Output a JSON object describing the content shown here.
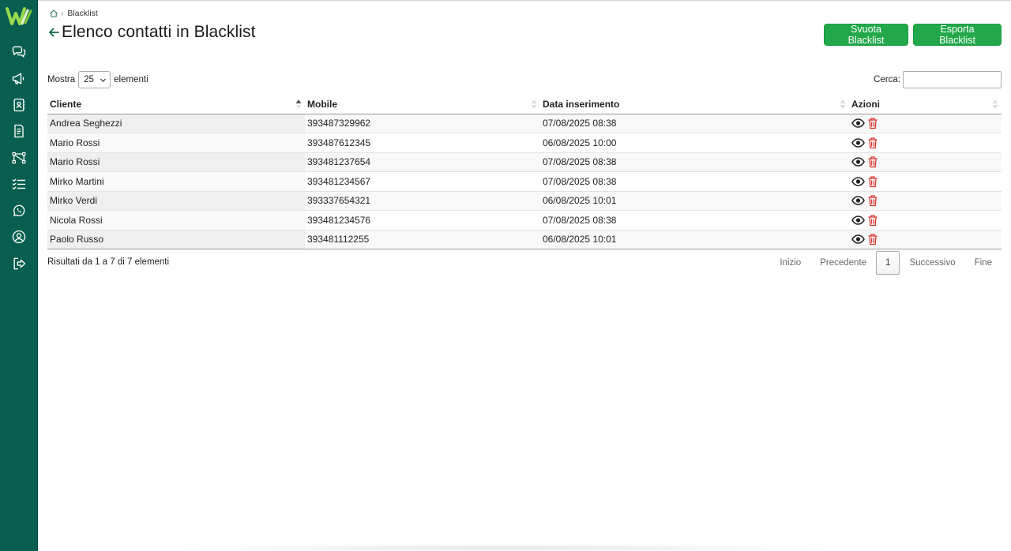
{
  "breadcrumb": {
    "current": "Blacklist"
  },
  "page": {
    "title": "Elenco contatti in Blacklist"
  },
  "toolbar": {
    "svuota_label": "Svuota Blacklist",
    "esporta_label": "Esporta Blacklist"
  },
  "length": {
    "prefix": "Mostra",
    "value": "25",
    "suffix": "elementi"
  },
  "search": {
    "label": "Cerca:",
    "value": ""
  },
  "table": {
    "columns": [
      "Cliente",
      "Mobile",
      "Data inserimento",
      "Azioni"
    ],
    "rows": [
      {
        "cliente": "Andrea Seghezzi",
        "mobile": "393487329962",
        "data": "07/08/2025 08:38"
      },
      {
        "cliente": "Mario Rossi",
        "mobile": "393487612345",
        "data": "06/08/2025 10:00"
      },
      {
        "cliente": "Mario Rossi",
        "mobile": "393481237654",
        "data": "07/08/2025 08:38"
      },
      {
        "cliente": "Mirko Martini",
        "mobile": "393481234567",
        "data": "07/08/2025 08:38"
      },
      {
        "cliente": "Mirko Verdi",
        "mobile": "393337654321",
        "data": "06/08/2025 10:01"
      },
      {
        "cliente": "Nicola Rossi",
        "mobile": "393481234576",
        "data": "07/08/2025 08:38"
      },
      {
        "cliente": "Paolo Russo",
        "mobile": "393481112255",
        "data": "06/08/2025 10:01"
      }
    ]
  },
  "info": "Risultati da 1 a 7 di 7 elementi",
  "pagination": {
    "first": "Inizio",
    "prev": "Precedente",
    "current": "1",
    "next": "Successivo",
    "last": "Fine"
  },
  "colors": {
    "sidebar": "#095f4f",
    "accent": "#22a84a",
    "delete": "#d9342b"
  },
  "icons": {
    "sidebar": [
      "chat-icon",
      "megaphone-icon",
      "contacts-book-icon",
      "document-icon",
      "workflow-icon",
      "checklist-icon",
      "whatsapp-icon",
      "user-circle-icon",
      "logout-icon"
    ],
    "actions": [
      "eye-icon",
      "trash-icon"
    ]
  }
}
